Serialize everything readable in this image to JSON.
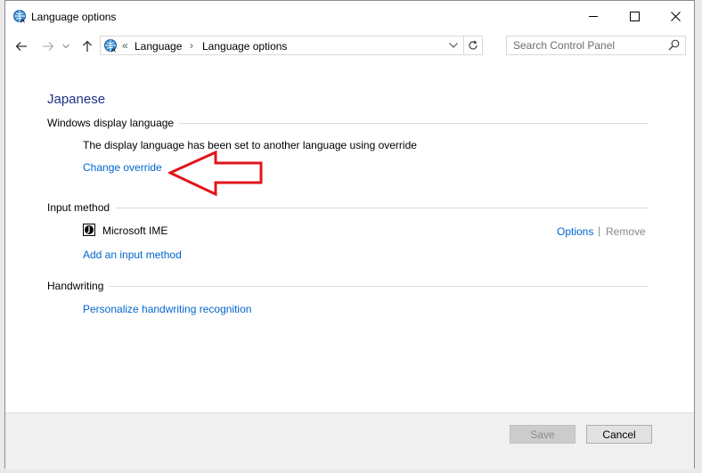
{
  "window": {
    "title": "Language options",
    "icon": "control-panel-globe-icon"
  },
  "nav": {
    "address_prefix": "«",
    "breadcrumbs": [
      {
        "label": "Language"
      },
      {
        "label": "Language options"
      }
    ],
    "separator": "›",
    "search_placeholder": "Search Control Panel"
  },
  "content": {
    "heading": "Japanese",
    "display_language": {
      "label": "Windows display language",
      "status_text": "The display language has been set to another language using override",
      "change_link": "Change override"
    },
    "input_method": {
      "label": "Input method",
      "ime_name": "Microsoft IME",
      "options_link": "Options",
      "separator": "|",
      "remove_link": "Remove",
      "add_link": "Add an input method"
    },
    "handwriting": {
      "label": "Handwriting",
      "personalize_link": "Personalize handwriting recognition"
    }
  },
  "footer": {
    "save_label": "Save",
    "cancel_label": "Cancel"
  },
  "colors": {
    "link": "#0066cc",
    "heading": "#1e3287",
    "annotation_arrow": "#e0161b"
  }
}
